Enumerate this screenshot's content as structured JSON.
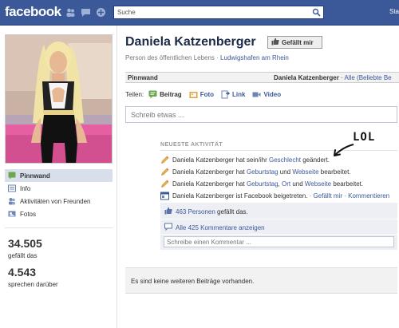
{
  "topbar": {
    "logo": "facebook",
    "search_placeholder": "Suche",
    "right_text": "Sta"
  },
  "profile": {
    "name": "Daniela Katzenberger",
    "like_button": "Gefällt mir",
    "category": "Person des öffentlichen Lebens",
    "separator": " · ",
    "location": "Ludwigshafen am Rhein"
  },
  "sidebar": {
    "items": [
      {
        "label": "Pinnwand",
        "icon": "wall-icon"
      },
      {
        "label": "Info",
        "icon": "info-icon"
      },
      {
        "label": "Aktivitäten von Freunden",
        "icon": "friends-icon"
      },
      {
        "label": "Fotos",
        "icon": "photos-icon"
      }
    ],
    "stats": [
      {
        "value": "34.505",
        "label": "gefällt das"
      },
      {
        "value": "4.543",
        "label": "sprechen darüber"
      }
    ]
  },
  "wall": {
    "tab_left": "Pinnwand",
    "tab_right_bold": "Daniela Katzenberger",
    "tab_right_sep": " · ",
    "tab_right_link": "Alle (Beliebte Be"
  },
  "share": {
    "label": "Teilen:",
    "options": [
      {
        "label": "Beitrag",
        "icon": "status-icon"
      },
      {
        "label": "Foto",
        "icon": "photo-icon"
      },
      {
        "label": "Link",
        "icon": "link-icon"
      },
      {
        "label": "Video",
        "icon": "video-icon"
      }
    ],
    "placeholder": "Schreib etwas ..."
  },
  "activity": {
    "heading": "NEUESTE AKTIVITÄT",
    "line1": {
      "a": "Daniela Katzenberger hat sein/ihr ",
      "l1": "Geschlecht",
      "b": " geändert."
    },
    "line2": {
      "a": "Daniela Katzenberger hat ",
      "l1": "Geburtstag",
      "b": " und ",
      "l2": "Webseite",
      "c": " bearbeitet."
    },
    "line3": {
      "a": "Daniela Katzenberger hat ",
      "l1": "Geburtstag",
      "b": ", ",
      "l2": "Ort",
      "c": " und ",
      "l3": "Webseite",
      "d": " bearbeitet."
    },
    "line4": {
      "a": "Daniela Katzenberger ist Facebook beigetreten.",
      "meta": " · ",
      "l1": "Gefällt mir",
      "sep": " · ",
      "l2": "Kommentieren"
    }
  },
  "annotation": "LOL",
  "likes": {
    "count_link": "463 Personen",
    "count_suffix": " gefällt das.",
    "comments_link": "Alle 425 Kommentare anzeigen",
    "comment_placeholder": "Schreibe einen Kommentar ..."
  },
  "footer": {
    "no_more": "Es sind keine weiteren Beiträge vorhanden."
  },
  "colors": {
    "brand": "#3b5998",
    "nav_active": "#d8dfea",
    "likes_bg": "#edeff4"
  }
}
